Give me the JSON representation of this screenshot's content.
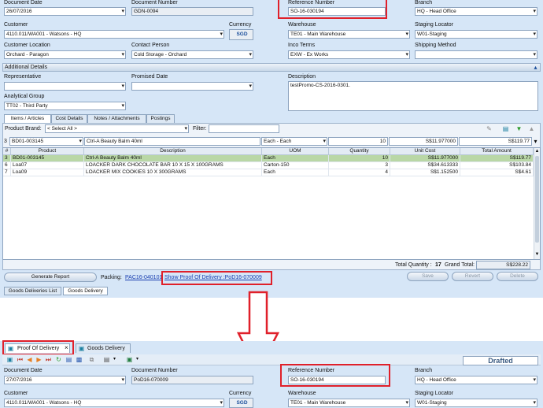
{
  "top": {
    "document_date_label": "Document Date",
    "document_date": "26/07/2016",
    "document_number_label": "Document Number",
    "document_number": "GDN-0094",
    "reference_number_label": "Reference Number",
    "reference_number": "SO-16-030194",
    "branch_label": "Branch",
    "branch": "HQ - Head Office",
    "customer_label": "Customer",
    "customer": "4110.011/WA001 - Watsons - HQ",
    "currency_label": "Currency",
    "currency": "SGD",
    "warehouse_label": "Warehouse",
    "warehouse": "TE01 - Main Warehouse",
    "staging_locator_label": "Staging Locator",
    "staging_locator": "W01-Staging",
    "customer_location_label": "Customer Location",
    "customer_location": "Orchard - Paragon",
    "contact_person_label": "Contact Person",
    "contact_person": "Cold Storage - Orchard",
    "inco_terms_label": "Inco Terms",
    "inco_terms": "EXW - Ex Works",
    "shipping_method_label": "Shipping Method",
    "shipping_method": "",
    "additional_details": "Additional Details",
    "representative_label": "Representative",
    "representative": "",
    "promised_date_label": "Promised Date",
    "promised_date": "",
    "description_label": "Description",
    "description": "testPromo-CS-2016-0301.",
    "analytical_group_label": "Analytical Group",
    "analytical_group": "TT02 - Third Party",
    "tabs": [
      "Items / Articles",
      "Cost Details",
      "Notes / Attachments",
      "Postings"
    ],
    "product_brand_label": "Product Brand:",
    "product_brand": "< Select All >",
    "filter_label": "Filter:",
    "filter_value": "",
    "edit_row": {
      "idx": "3",
      "product": "BD01-003145",
      "description": "Ctrl-A Beauty Balm   40ml",
      "uom": "Each - Each",
      "quantity": "10",
      "unit_cost": "S$11.977000",
      "total": "S$119.77"
    },
    "columns": [
      "#",
      "Product",
      "Description",
      "UOM",
      "Quantity",
      "Unit Cost",
      "Total Amount"
    ],
    "rows": [
      {
        "idx": "3",
        "product": "BD01-003145",
        "description": "Ctrl-A Beauty Balm   40ml",
        "uom": "Each",
        "quantity": "10",
        "unit_cost": "S$11.977000",
        "total": "S$119.77"
      },
      {
        "idx": "6",
        "product": "Loa07",
        "description": "LOACKER DARK CHOCOLATE BAR 10 X 15 X 100GRAMS",
        "uom": "Carton-150",
        "quantity": "3",
        "unit_cost": "S$34.613333",
        "total": "S$103.84"
      },
      {
        "idx": "7",
        "product": "Loa09",
        "description": "LOACKER MIX COOKIES 10 X 300GRAMS",
        "uom": "Each",
        "quantity": "4",
        "unit_cost": "S$1.152500",
        "total": "S$4.61"
      }
    ],
    "total_quantity_label": "Total Quantity :",
    "total_quantity": "17",
    "grand_total_label": "Grand Total:",
    "grand_total": "S$228.22",
    "generate_report": "Generate Report",
    "packing_label": "Packing:",
    "packing_value": "PAC16-040101",
    "pod_link": "Show Proof Of Delivery :PoD16-070009",
    "save": "Save",
    "revert": "Revert",
    "delete": "Delete",
    "bottom_tabs": [
      "Goods Deliveries List",
      "Goods Delivery"
    ]
  },
  "bottom": {
    "tabs": [
      "Proof Of Delivery",
      "Goods Delivery"
    ],
    "close_glyph": "×",
    "status": "Drafted",
    "document_date_label": "Document Date",
    "document_date": "27/07/2016",
    "document_number_label": "Document Number",
    "document_number": "PoD16-070009",
    "reference_number_label": "Reference Number",
    "reference_number": "SO-16-030194",
    "branch_label": "Branch",
    "branch": "HQ - Head Office",
    "customer_label": "Customer",
    "customer": "4110.011/WA001 - Watsons - HQ",
    "currency_label": "Currency",
    "currency": "SGD",
    "warehouse_label": "Warehouse",
    "warehouse": "TE01 - Main Warehouse",
    "staging_locator_label": "Staging Locator",
    "staging_locator": "W01-Staging"
  },
  "colors": {
    "highlight": "#e0202a",
    "panel": "#d6e6f7",
    "arrow": "#e0202a"
  }
}
